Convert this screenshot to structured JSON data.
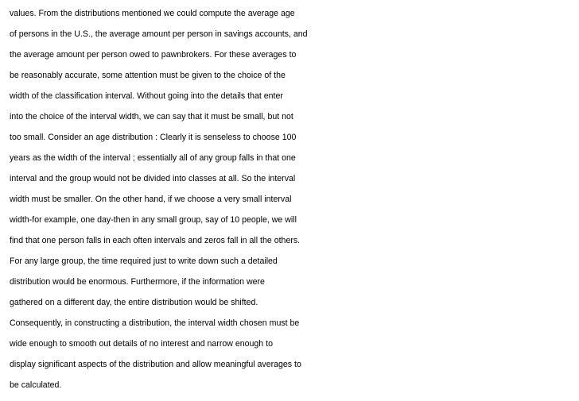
{
  "document": {
    "lines": [
      "values. From the distributions mentioned we could compute the average age",
      "of persons in the U.S., the average amount per person in savings accounts, and",
      "the average amount per person owed to pawnbrokers. For these averages to",
      "be reasonably accurate, some attention must be given to the choice of the",
      "width of the classification interval. Without going into the details that enter",
      "into the choice of the interval width, we can say that it must be small, but not",
      "too small. Consider an age distribution : Clearly it is senseless to choose 100",
      "years as the width of the interval ; essentially all of any group falls in that one",
      "interval and the group would not be divided into classes at all. So the interval",
      "width must be smaller. On the other hand, if we choose a very small interval",
      "width-for example, one day-then in any small group, say of 10 people, we will",
      "find that one person falls in each often intervals and zeros fall in all the others.",
      "For any large group, the time required just to write down such a detailed",
      "distribution would be enormous. Furthermore, if the information were",
      "gathered on a different day, the entire distribution would be shifted.",
      "Consequently, in constructing a distribution, the interval width chosen must be",
      "wide enough to smooth out details of no interest and narrow enough to",
      "display significant aspects of the distribution and allow meaningful averages to",
      "be calculated."
    ]
  }
}
